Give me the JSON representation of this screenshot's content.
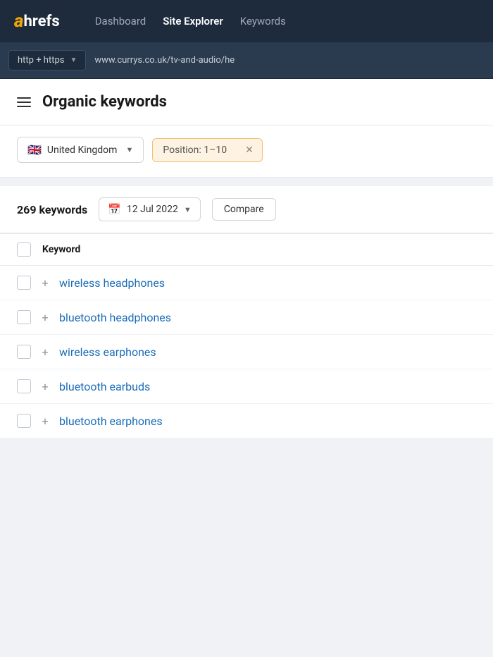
{
  "nav": {
    "logo_a": "a",
    "logo_hrefs": "hrefs",
    "links": [
      {
        "label": "Dashboard",
        "active": false
      },
      {
        "label": "Site Explorer",
        "active": true
      },
      {
        "label": "Keywords",
        "active": false
      }
    ]
  },
  "urlbar": {
    "protocol": "http + https",
    "protocol_chevron": "▼",
    "url": "www.currys.co.uk/tv-and-audio/he"
  },
  "page": {
    "title": "Organic keywords"
  },
  "filters": {
    "country_flag": "🇬🇧",
    "country_name": "United Kingdom",
    "country_chevron": "▼",
    "position_label": "Position: 1–10",
    "position_close": "✕"
  },
  "keywords_bar": {
    "count_label": "269 keywords",
    "date_label": "12 Jul 2022",
    "date_chevron": "▼",
    "compare_label": "Compare"
  },
  "table": {
    "header": {
      "keyword_label": "Keyword"
    },
    "rows": [
      {
        "keyword": "wireless headphones"
      },
      {
        "keyword": "bluetooth headphones"
      },
      {
        "keyword": "wireless earphones"
      },
      {
        "keyword": "bluetooth earbuds"
      },
      {
        "keyword": "bluetooth earphones"
      }
    ]
  }
}
